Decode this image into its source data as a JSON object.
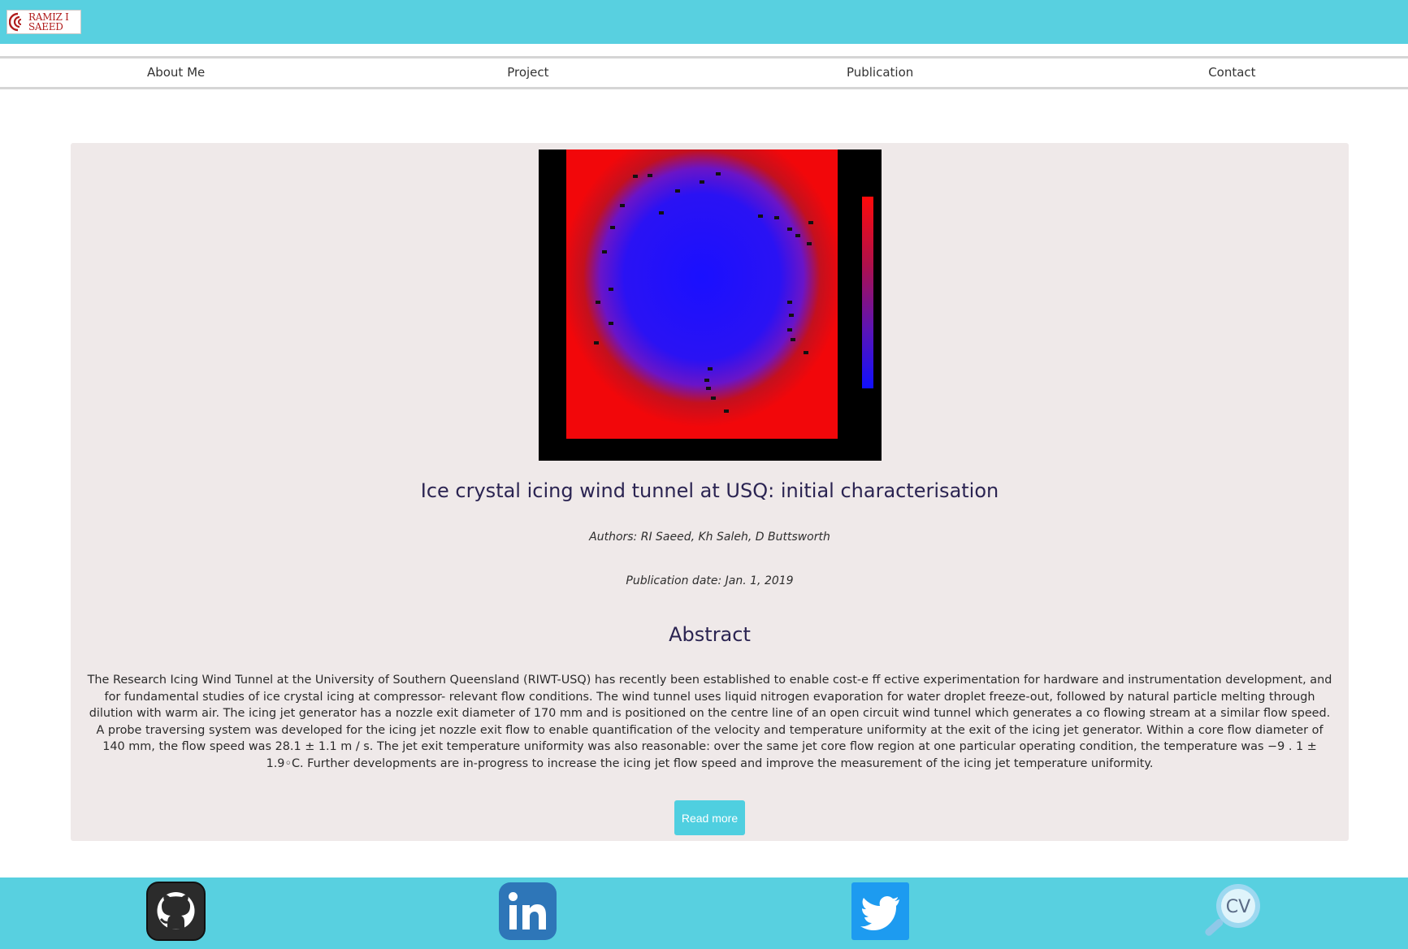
{
  "header": {
    "logo_line1": "RAMIZ I",
    "logo_line2": "SAEED",
    "logo_icon": "logo-mark-icon"
  },
  "nav": {
    "items": [
      {
        "label": "About Me"
      },
      {
        "label": "Project"
      },
      {
        "label": "Publication"
      },
      {
        "label": "Contact"
      }
    ]
  },
  "publication": {
    "title": "Ice crystal icing wind tunnel at USQ: initial characterisation",
    "authors": "Authors: RI Saeed, Kh Saleh, D Buttsworth",
    "date": "Publication date: Jan. 1, 2019",
    "abstract_heading": "Abstract",
    "abstract": "The Research Icing Wind Tunnel at the University of Southern Queensland (RIWT-USQ) has recently been established to enable cost-e ff ective experimentation for hardware and instrumentation development, and for fundamental studies of ice crystal icing at compressor- relevant flow conditions. The wind tunnel uses liquid nitrogen evaporation for water droplet freeze-out, followed by natural particle melting through dilution with warm air. The icing jet generator has a nozzle exit diameter of 170 mm and is positioned on the centre line of an open circuit wind tunnel which generates a co flowing stream at a similar flow speed. A probe traversing system was developed for the icing jet nozzle exit flow to enable quantification of the velocity and temperature uniformity at the exit of the icing jet generator. Within a core flow diameter of 140 mm, the flow speed was 28.1 ± 1.1 m / s. The jet exit temperature uniformity was also reasonable: over the same jet core flow region at one particular operating condition, the temperature was −9 . 1 ± 1.9◦C. Further developments are in-progress to increase the icing jet flow speed and improve the measurement of the icing jet temperature uniformity.",
    "read_more_label": "Read more",
    "figure_icon": "temperature-contour-figure"
  },
  "footer": {
    "links": [
      {
        "icon": "github-icon"
      },
      {
        "icon": "linkedin-icon"
      },
      {
        "icon": "twitter-icon"
      },
      {
        "icon": "cv-icon",
        "label": "CV"
      }
    ]
  },
  "colors": {
    "bar": "#58d0e0",
    "card": "#efe9e9",
    "heading": "#2b2452",
    "button": "#4fcfe0"
  }
}
